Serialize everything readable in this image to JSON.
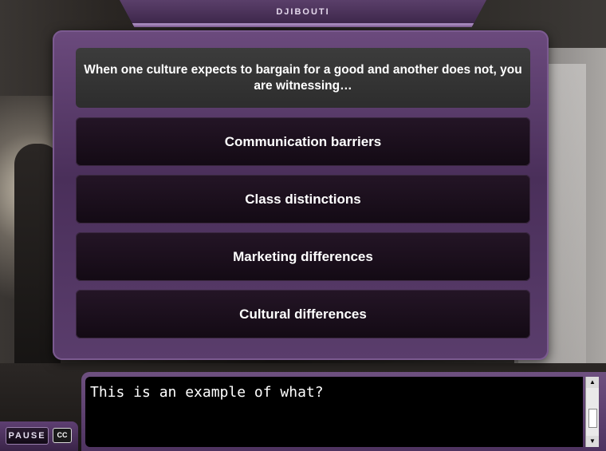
{
  "header": {
    "title": "DJIBOUTI"
  },
  "quiz": {
    "question": "When one culture expects to bargain for a good and another does not, you are witnessing…",
    "answers": [
      "Communication barriers",
      "Class distinctions",
      "Marketing differences",
      "Cultural differences"
    ]
  },
  "caption": {
    "text": "This is an example of what?"
  },
  "controls": {
    "pause_label": "PAUSE",
    "cc_label": "CC"
  },
  "colors": {
    "panel_purple": "#5a3d6c",
    "answer_bg": "#1b0f1d",
    "question_bg": "#333333"
  },
  "icons": {
    "scroll_up": "triangle-up-icon",
    "scroll_down": "triangle-down-icon",
    "closed_captions": "cc-icon"
  }
}
